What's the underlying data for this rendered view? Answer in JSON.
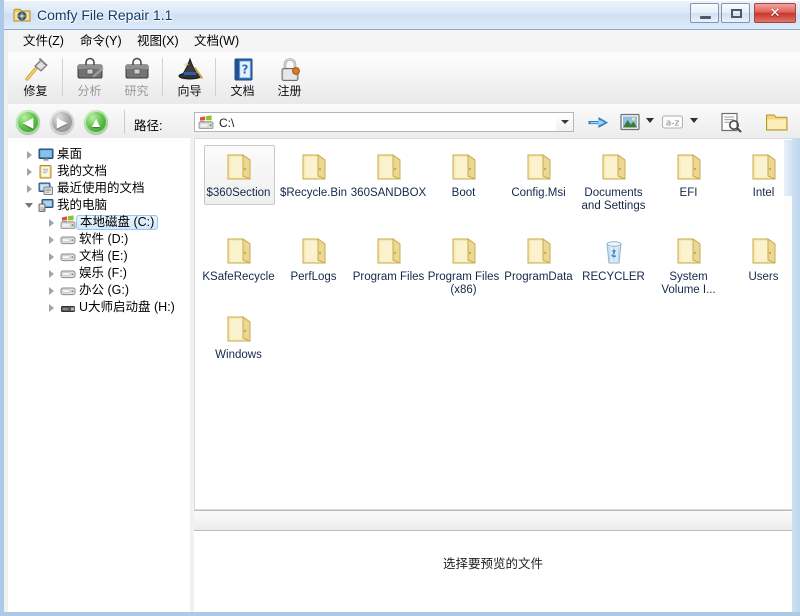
{
  "window": {
    "title": "Comfy File Repair 1.1",
    "app_icon": "folder-gear-icon",
    "controls": {
      "minimize": "minimize-button",
      "maximize": "maximize-button",
      "close_glyph": "✕"
    }
  },
  "menubar": {
    "items": [
      {
        "label": "文件(Z)",
        "name": "menu-file"
      },
      {
        "label": "命令(Y)",
        "name": "menu-command"
      },
      {
        "label": "视图(X)",
        "name": "menu-view"
      },
      {
        "label": "文档(W)",
        "name": "menu-document"
      }
    ]
  },
  "toolbar": {
    "buttons": [
      {
        "label": "修复",
        "icon": "hammer-icon",
        "enabled": true
      },
      {
        "label": "分析",
        "icon": "toolbox-wrench-icon",
        "enabled": false
      },
      {
        "label": "研究",
        "icon": "toolbox-icon",
        "enabled": false
      },
      {
        "label": "向导",
        "icon": "wizard-hat-icon",
        "enabled": true
      },
      {
        "label": "文档",
        "icon": "blue-book-help-icon",
        "enabled": true
      },
      {
        "label": "注册",
        "icon": "padlock-icon",
        "enabled": true
      }
    ]
  },
  "navbar": {
    "back": "◀",
    "forward": "▶",
    "up": "▲",
    "path_label": "路径:",
    "path_value": "C:\\",
    "path_placeholder": "C:\\",
    "path_drive_icon": "windows-drive-icon",
    "go_icon": "blue-arrow-go-icon",
    "view_icon": "thumbnail-view-icon",
    "sort_icon": "a-z-sort-icon",
    "sort_icon_label": "a-z",
    "preview_icon": "preview-document-icon",
    "folder_icon": "open-folder-icon"
  },
  "tree": {
    "items": [
      {
        "label": "桌面",
        "icon": "desktop-icon",
        "indent": 0,
        "expander": "collapsed",
        "selected": false
      },
      {
        "label": "我的文档",
        "icon": "documents-icon",
        "indent": 0,
        "expander": "collapsed",
        "selected": false
      },
      {
        "label": "最近使用的文档",
        "icon": "recent-documents-icon",
        "indent": 0,
        "expander": "collapsed",
        "selected": false
      },
      {
        "label": "我的电脑",
        "icon": "computer-icon",
        "indent": 0,
        "expander": "expanded",
        "selected": false
      },
      {
        "label": "本地磁盘 (C:)",
        "icon": "windows-drive-icon",
        "indent": 1,
        "expander": "collapsed",
        "selected": true
      },
      {
        "label": "软件 (D:)",
        "icon": "drive-icon",
        "indent": 1,
        "expander": "collapsed",
        "selected": false
      },
      {
        "label": "文档 (E:)",
        "icon": "drive-icon",
        "indent": 1,
        "expander": "collapsed",
        "selected": false
      },
      {
        "label": "娱乐 (F:)",
        "icon": "drive-icon",
        "indent": 1,
        "expander": "collapsed",
        "selected": false
      },
      {
        "label": "办公 (G:)",
        "icon": "drive-icon",
        "indent": 1,
        "expander": "collapsed",
        "selected": false
      },
      {
        "label": "U大师启动盘 (H:)",
        "icon": "usb-drive-icon",
        "indent": 1,
        "expander": "collapsed",
        "selected": false
      }
    ]
  },
  "files": {
    "items": [
      {
        "label": "$360Section",
        "icon": "folder-icon",
        "selected": true
      },
      {
        "label": "$Recycle.Bin",
        "icon": "folder-icon",
        "selected": false
      },
      {
        "label": "360SANDBOX",
        "icon": "folder-icon",
        "selected": false
      },
      {
        "label": "Boot",
        "icon": "folder-icon",
        "selected": false
      },
      {
        "label": "Config.Msi",
        "icon": "folder-icon",
        "selected": false
      },
      {
        "label": "Documents and Settings",
        "icon": "folder-icon",
        "selected": false
      },
      {
        "label": "EFI",
        "icon": "folder-icon",
        "selected": false
      },
      {
        "label": "Intel",
        "icon": "folder-icon",
        "selected": false
      },
      {
        "label": "KSafeRecycle",
        "icon": "folder-icon",
        "selected": false
      },
      {
        "label": "PerfLogs",
        "icon": "folder-icon",
        "selected": false
      },
      {
        "label": "Program Files",
        "icon": "folder-icon",
        "selected": false
      },
      {
        "label": "Program Files (x86)",
        "icon": "folder-icon",
        "selected": false
      },
      {
        "label": "ProgramData",
        "icon": "folder-icon",
        "selected": false
      },
      {
        "label": "RECYCLER",
        "icon": "recycle-bin-icon",
        "selected": false
      },
      {
        "label": "System Volume I...",
        "icon": "folder-icon",
        "selected": false
      },
      {
        "label": "Users",
        "icon": "folder-icon",
        "selected": false
      },
      {
        "label": "Windows",
        "icon": "folder-icon",
        "selected": false
      }
    ]
  },
  "preview": {
    "empty_text": "选择要预览的文件"
  },
  "colors": {
    "title_text": "#123b6b",
    "folder_yellow": "#f4e3a1",
    "selection_blue": "#d2e8fb",
    "close_red": "#c8362c",
    "nav_green": "#2a8a22"
  }
}
